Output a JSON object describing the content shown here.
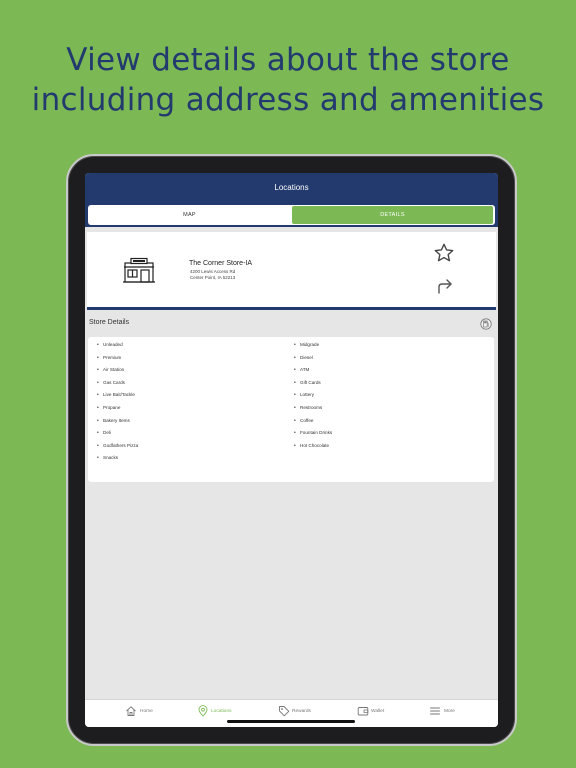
{
  "headline": {
    "line1": "View details about the store",
    "line2": "including address and amenities"
  },
  "nav": {
    "title": "Locations"
  },
  "segments": {
    "map_label": "MAP",
    "details_label": "DETAILS",
    "selected": "DETAILS"
  },
  "store": {
    "name": "The Corner Store-IA",
    "address_line1": "4200 Lewis Access Rd",
    "address_line2": "Center Point, IA 52213",
    "icon": "store-front-icon",
    "favorite_icon": "star-outline-icon",
    "directions_icon": "share-arrow-icon"
  },
  "details": {
    "title": "Store Details",
    "icon": "fuel-pump-icon",
    "left_column": [
      "Unleaded",
      "Premium",
      "Air Station",
      "Gas Cards",
      "Live Bait/Tackle",
      "Propane",
      "Bakery Items",
      "Deli",
      "Godfathers Pizza",
      "Snacks"
    ],
    "right_column": [
      "Midgrade",
      "Diesel",
      "ATM",
      "Gift Cards",
      "Lottery",
      "Restrooms",
      "Coffee",
      "Fountain Drinks",
      "Hot Chocolate"
    ]
  },
  "tabbar": {
    "home": "Home",
    "locations": "Locations",
    "rewards": "Rewards",
    "wallet": "Wallet",
    "more": "More",
    "active": "Locations"
  },
  "colors": {
    "background": "#7cb955",
    "navy": "#233a6e",
    "accent_green": "#7cb955"
  }
}
